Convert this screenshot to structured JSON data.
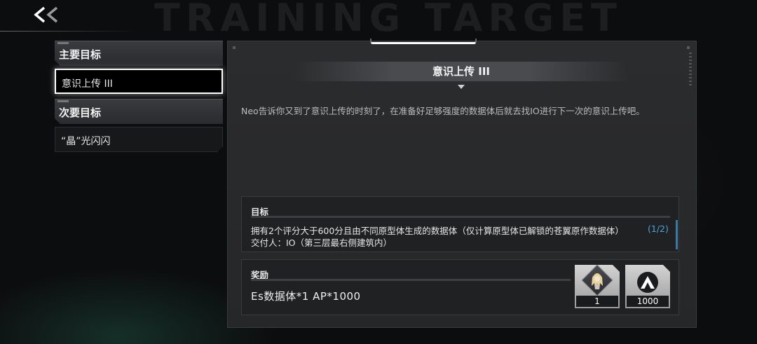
{
  "header": {
    "back_label": "<<",
    "bg_title": "TRAINING TARGET"
  },
  "sidebar": {
    "main_header": "主要目标",
    "main_items": [
      "意识上传 III"
    ],
    "secondary_header": "次要目标",
    "secondary_items": [
      "“晶”光闪闪"
    ]
  },
  "quest": {
    "title": "意识上传 III",
    "description": "Neo告诉你又到了意识上传的时刻了，在准备好足够强度的数据体后就去找IO进行下一次的意识上传吧。"
  },
  "objective": {
    "label": "目标",
    "text": "拥有2个评分大于600分且由不同原型体生成的数据体（仅计算原型体已解锁的苍翼原作数据体）",
    "progress": "(1/2)",
    "submitter": "交付人：IO（第三层最右侧建筑内）"
  },
  "reward": {
    "label": "奖励",
    "text": "Es数据体*1  AP*1000",
    "items": [
      {
        "icon": "character-portrait-icon",
        "count": "1"
      },
      {
        "icon": "ap-logo-icon",
        "count": "1000"
      }
    ]
  },
  "colors": {
    "progress": "#4fa3e0",
    "accent": "#3b79a8",
    "active_border": "#ffffff"
  }
}
